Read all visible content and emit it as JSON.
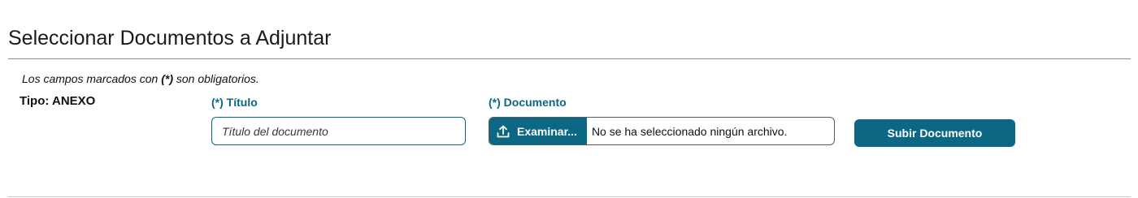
{
  "section": {
    "title": "Seleccionar Documentos a Adjuntar",
    "required_note_prefix": "Los campos marcados con",
    "required_marker": "(*)",
    "required_note_suffix": "son obligatorios."
  },
  "tipo": {
    "label": "Tipo: ANEXO"
  },
  "titulo_field": {
    "label": "(*) Título",
    "placeholder": "Título del documento",
    "value": ""
  },
  "documento_field": {
    "label": "(*) Documento",
    "browse_label": "Examinar...",
    "browse_icon": "upload-icon",
    "status": "No se ha seleccionado ningún archivo."
  },
  "upload_button": {
    "label": "Subir Documento"
  },
  "colors": {
    "accent": "#0b6784",
    "rule": "#8a8a8a"
  }
}
